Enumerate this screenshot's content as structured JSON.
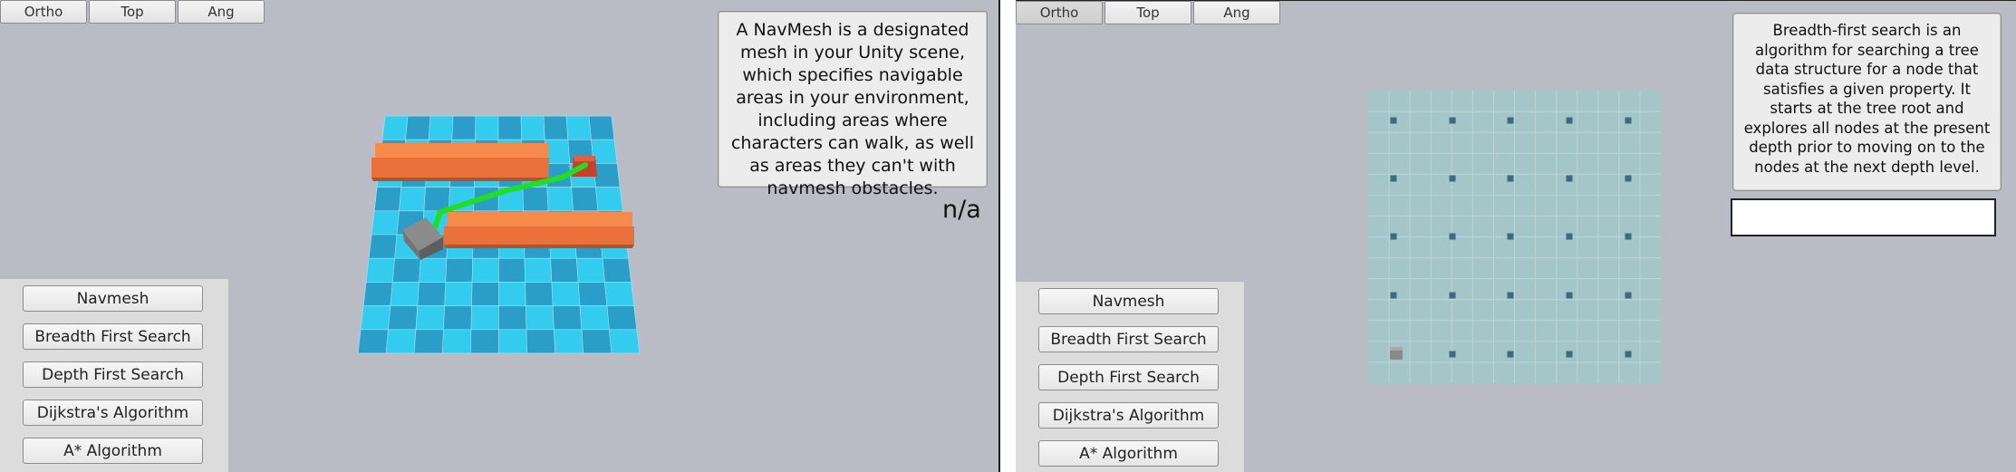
{
  "left_view": {
    "toolbar": {
      "ortho_label": "Ortho",
      "top_label": "Top",
      "ang_label": "Ang"
    },
    "info_text": "A NavMesh is a designated mesh in your Unity scene, which specifies navigable areas in your environment, including areas where characters can walk, as well as areas they can't with navmesh obstacles.",
    "status_text": "n/a",
    "algorithms": [
      "Navmesh",
      "Breadth First Search",
      "Depth First Search",
      "Dijkstra's Algorithm",
      "A* Algorithm"
    ],
    "colors": {
      "tile_light": "#33ccee",
      "tile_dark": "#2a9dc8",
      "obstacle": "#f07838",
      "target": "#c8402a",
      "path": "#22dd22",
      "agent": "#6e6e6e"
    }
  },
  "right_view": {
    "toolbar": {
      "ortho_label": "Ortho",
      "top_label": "Top",
      "ang_label": "Ang"
    },
    "info_text": "Breadth-first search is an algorithm for searching a tree data structure for a node that satisfies a given property. It starts at the tree root and explores all nodes at the present depth prior to moving on to the nodes at the next depth level.",
    "status_text": "",
    "algorithms": [
      "Navmesh",
      "Breadth First Search",
      "Depth First Search",
      "Dijkstra's Algorithm",
      "A* Algorithm"
    ],
    "colors": {
      "grid": "#a4c6c8",
      "grid_line": "#bcd6d6",
      "node": "#3d6a80",
      "agent": "#808080"
    }
  }
}
